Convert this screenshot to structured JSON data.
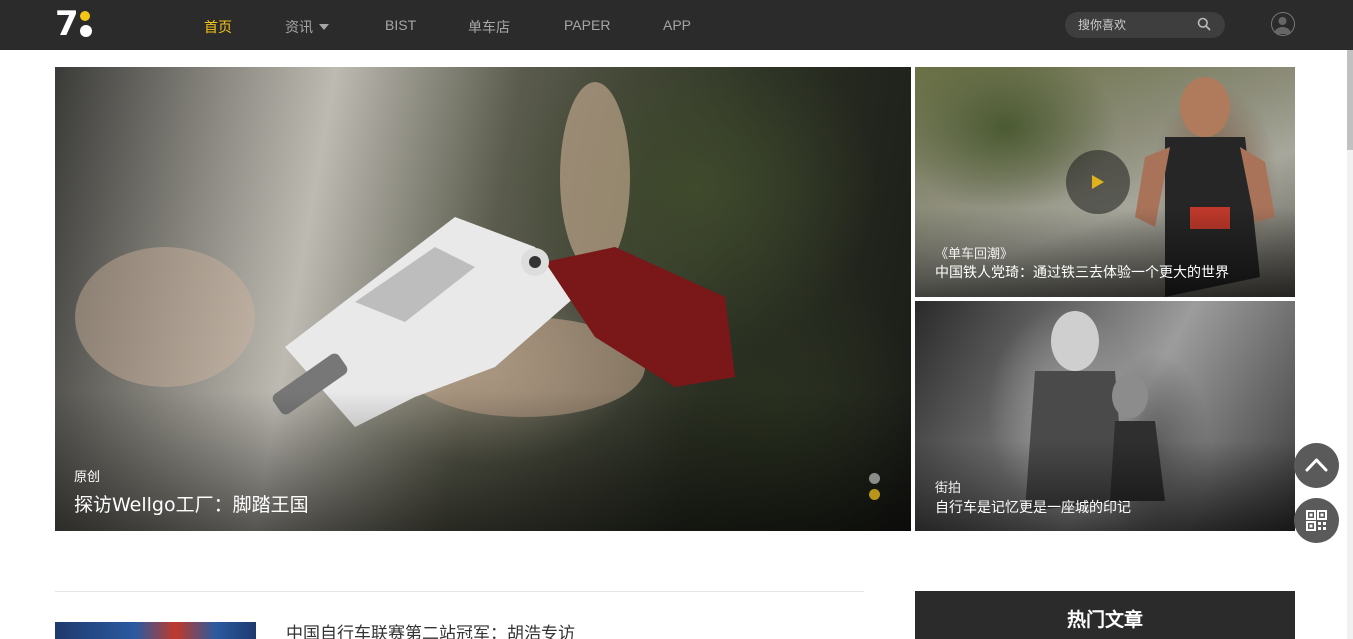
{
  "header": {
    "nav": [
      {
        "label": "首页",
        "active": true
      },
      {
        "label": "资讯",
        "has_dropdown": true
      },
      {
        "label": "BIST"
      },
      {
        "label": "单车店"
      },
      {
        "label": "PAPER"
      },
      {
        "label": "APP"
      }
    ],
    "search": {
      "placeholder": "搜你喜欢"
    },
    "icons": {
      "logo": "7-with-dots-logo",
      "search": "search-icon",
      "avatar": "user-avatar-icon"
    }
  },
  "hero": {
    "main": {
      "tag": "原创",
      "title": "探访Wellgo工厂：脚踏王国",
      "slide_count": 2,
      "active_slide": 2
    },
    "side": [
      {
        "tag": "《单车回潮》",
        "title": "中国铁人党琦：通过铁三去体验一个更大的世界",
        "has_video": true
      },
      {
        "tag": "街拍",
        "title": "自行车是记忆更是一座城的印记"
      }
    ]
  },
  "articles": [
    {
      "title": "中国自行车联赛第二站冠军：胡浩专访"
    }
  ],
  "sidebar": {
    "hot_title": "热门文章"
  },
  "floating": {
    "back_to_top": "chevron-up-icon",
    "qr_code": "qr-code-icon"
  },
  "colors": {
    "topbar": "#2b2b2b",
    "accent": "#f5c518",
    "fab": "#5a5a5a"
  }
}
